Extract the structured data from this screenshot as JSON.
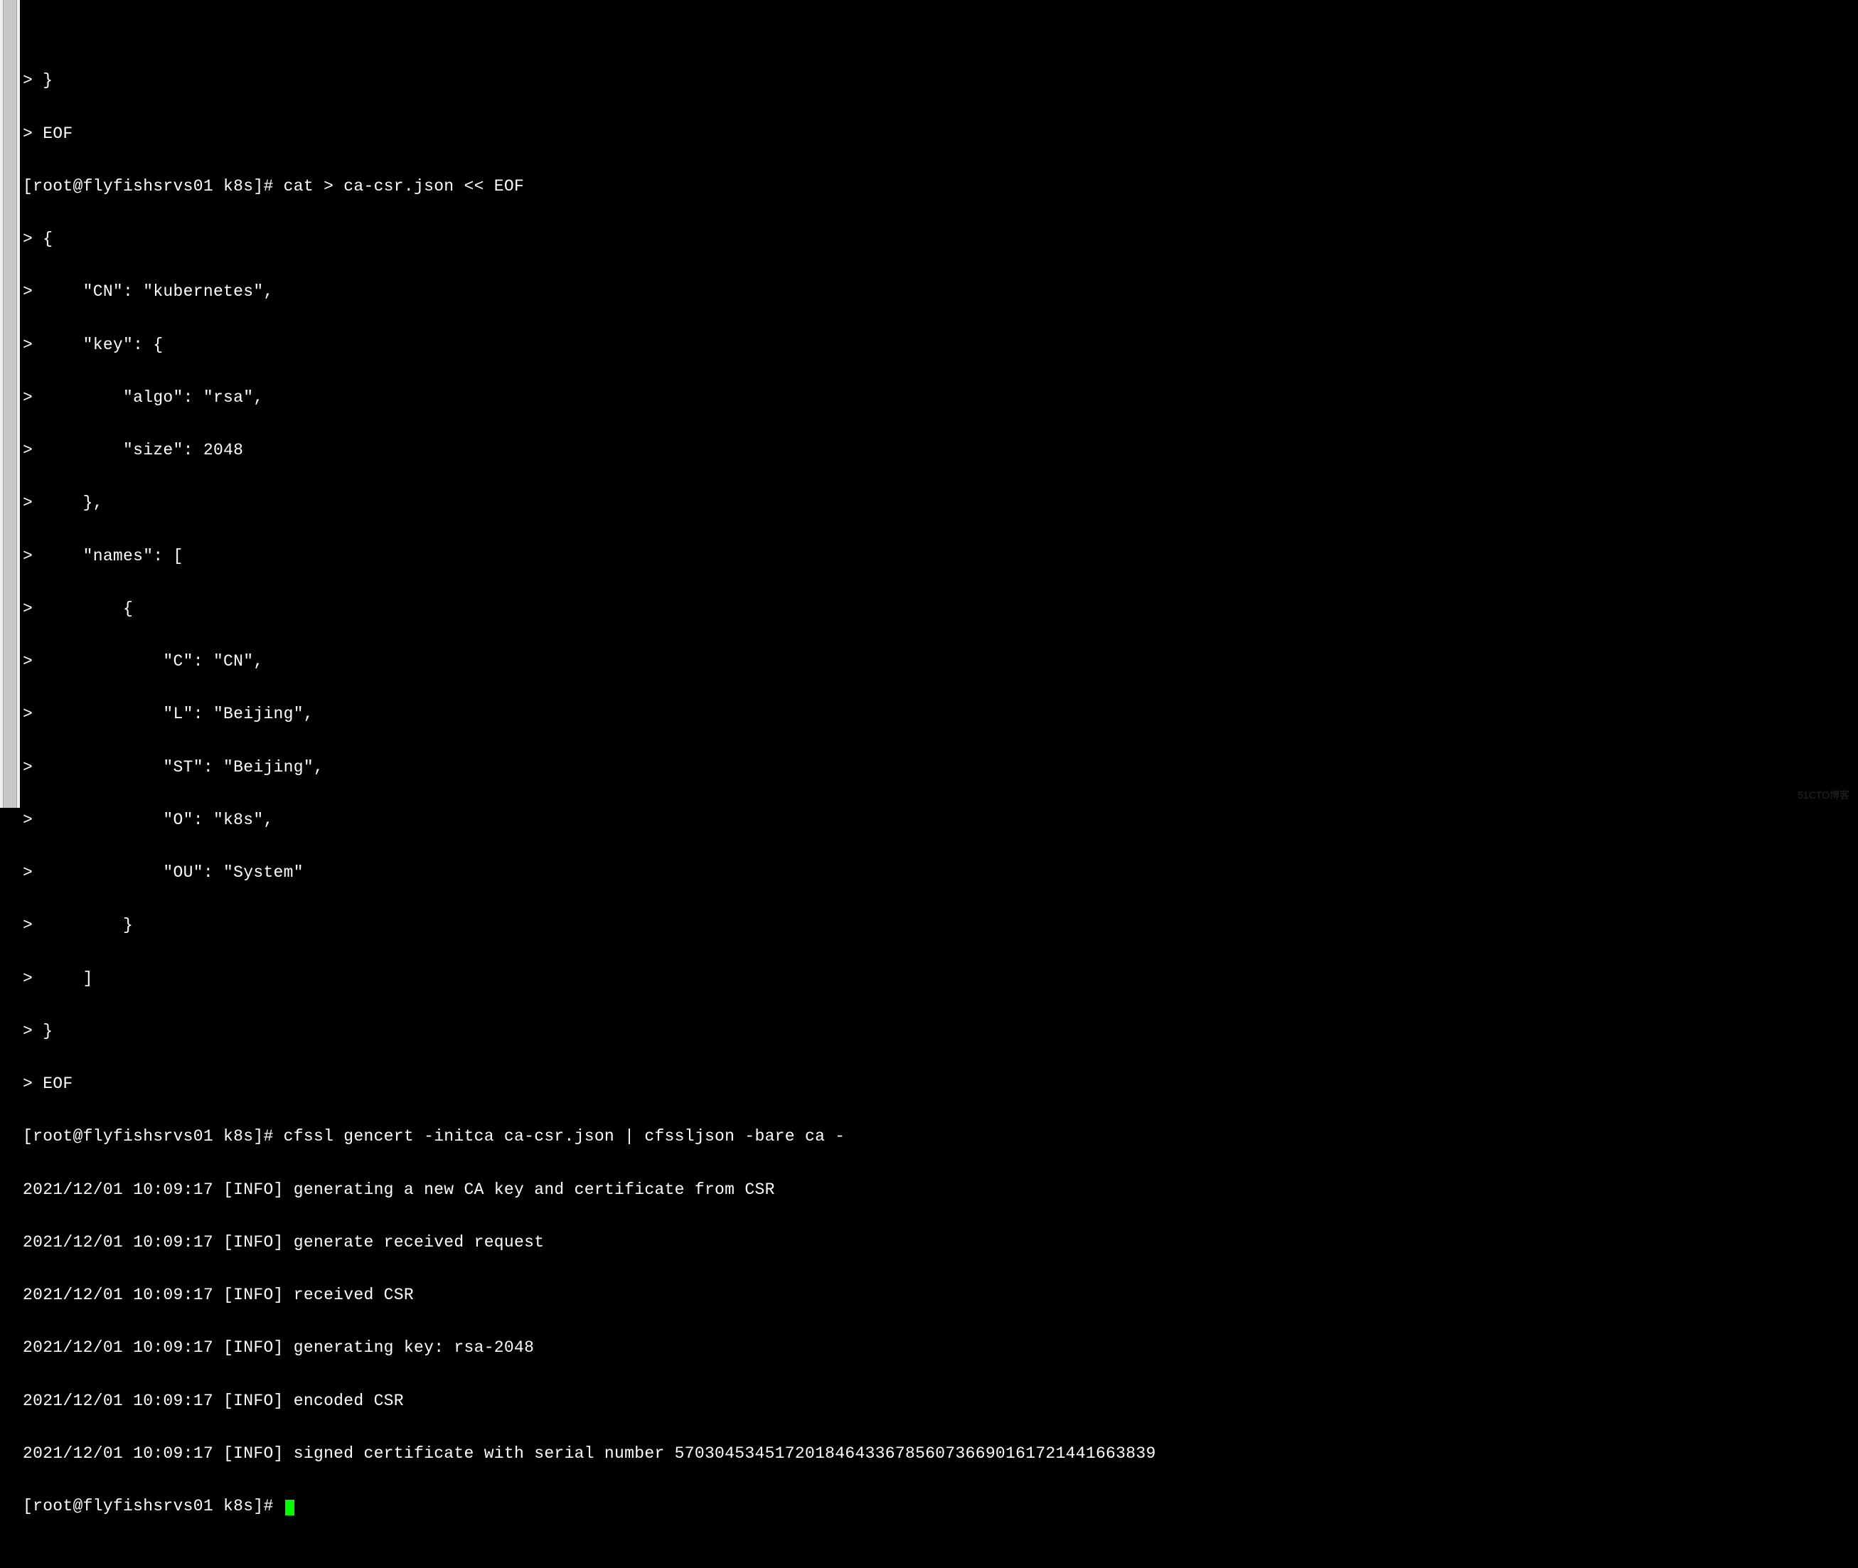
{
  "scrollbar": {
    "present": true
  },
  "lines": [
    "> }",
    "> EOF",
    "[root@flyfishsrvs01 k8s]# cat > ca-csr.json << EOF",
    "> {",
    ">     \"CN\": \"kubernetes\",",
    ">     \"key\": {",
    ">         \"algo\": \"rsa\",",
    ">         \"size\": 2048",
    ">     },",
    ">     \"names\": [",
    ">         {",
    ">             \"C\": \"CN\",",
    ">             \"L\": \"Beijing\",",
    ">             \"ST\": \"Beijing\",",
    ">             \"O\": \"k8s\",",
    ">             \"OU\": \"System\"",
    ">         }",
    ">     ]",
    "> }",
    "> EOF",
    "[root@flyfishsrvs01 k8s]# cfssl gencert -initca ca-csr.json | cfssljson -bare ca -",
    "2021/12/01 10:09:17 [INFO] generating a new CA key and certificate from CSR",
    "2021/12/01 10:09:17 [INFO] generate received request",
    "2021/12/01 10:09:17 [INFO] received CSR",
    "2021/12/01 10:09:17 [INFO] generating key: rsa-2048",
    "2021/12/01 10:09:17 [INFO] encoded CSR",
    "2021/12/01 10:09:17 [INFO] signed certificate with serial number 570304534517201846433678560736690161721441663839"
  ],
  "prompt_line": "[root@flyfishsrvs01 k8s]# ",
  "watermark": "51CTO博客"
}
